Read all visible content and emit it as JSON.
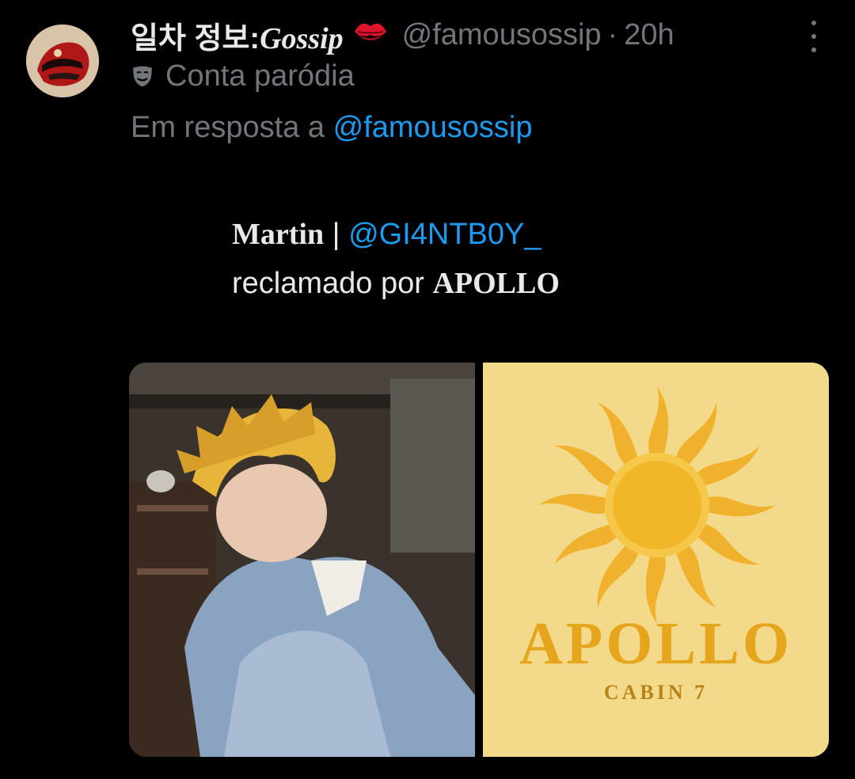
{
  "tweet": {
    "display_name": "일차 정보:",
    "display_name_script": "Gossip",
    "emoji_icon": "kiss-mark-icon",
    "handle": "@famousossip",
    "separator": "·",
    "time": "20h",
    "parody_label": "Conta paródia",
    "parody_icon": "parody-mask-icon",
    "reply_prefix": "Em resposta a",
    "reply_to": "@famousossip",
    "body": {
      "name": "Martin",
      "divider": " | ",
      "mention": "@GI4NTB0Y_",
      "claimed_text": "reclamado por ",
      "claimed_by": "APOLLO"
    }
  },
  "media": {
    "poster_title": "APOLLO",
    "poster_subtitle": "CABIN 7"
  },
  "colors": {
    "background": "#000000",
    "text": "#e7e9ea",
    "muted": "#71767b",
    "link": "#1d9bf0",
    "poster_bg": "#f3d98a",
    "poster_gold": "#e5a51c"
  }
}
